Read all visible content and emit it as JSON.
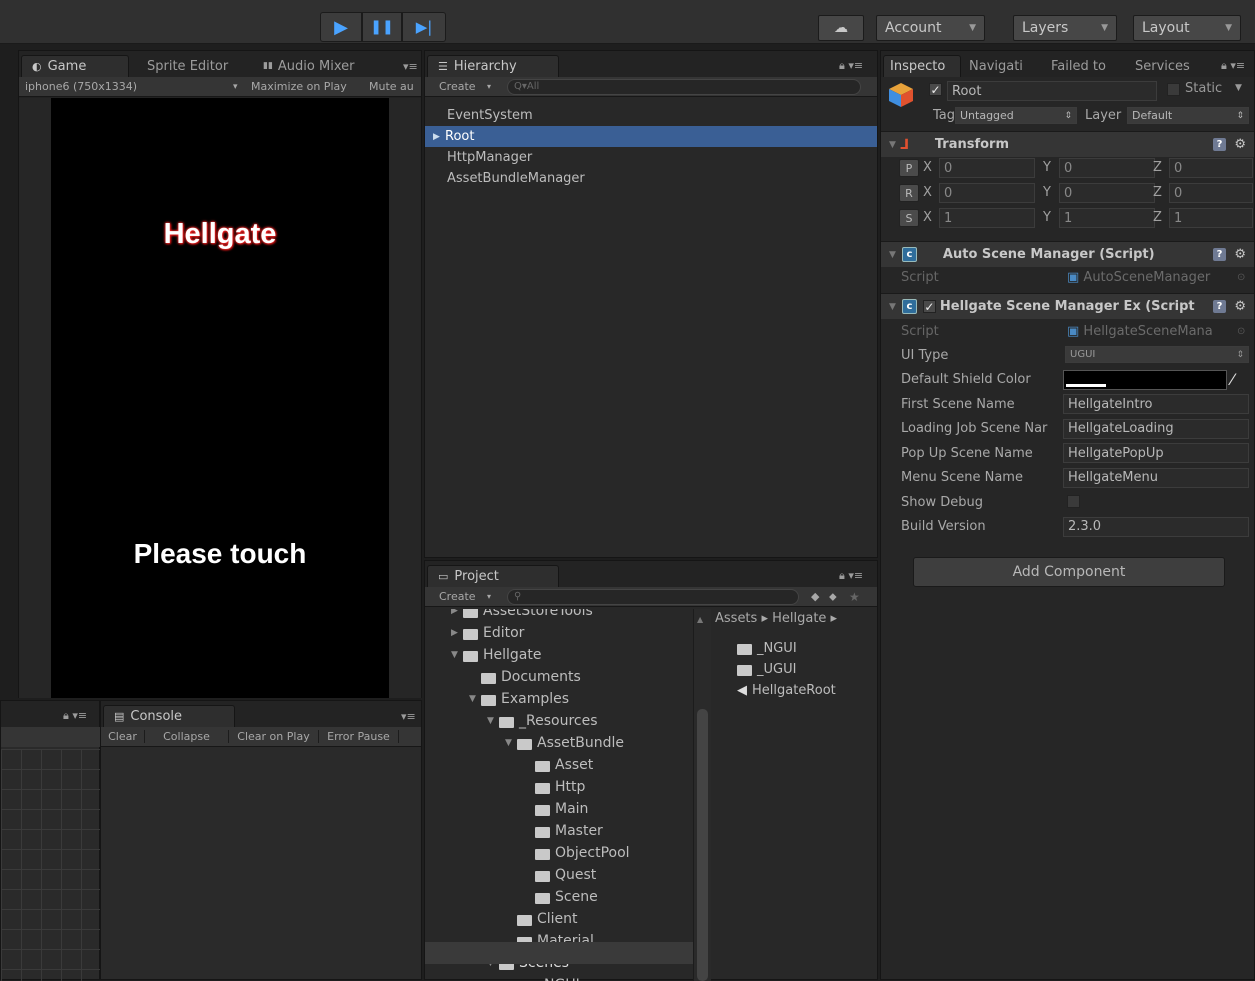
{
  "toolbar": {
    "play_icon": "play-icon",
    "account_label": "Account",
    "layers_label": "Layers",
    "layout_label": "Layout"
  },
  "game_panel": {
    "tabs": [
      "Game",
      "Sprite Editor",
      "Audio Mixer"
    ],
    "resolution": "iphone6 (750x1334)",
    "maximize_on_play": "Maximize on Play",
    "mute_audio": "Mute au",
    "title_text": "Hellgate",
    "touch_text": "Please touch"
  },
  "hierarchy": {
    "tab": "Hierarchy",
    "create_label": "Create",
    "search_placeholder": "Q▾All",
    "items": [
      "EventSystem",
      "Root",
      "HttpManager",
      "AssetBundleManager"
    ]
  },
  "console": {
    "tab": "Console",
    "buttons": [
      "Clear",
      "Collapse",
      "Clear on Play",
      "Error Pause"
    ]
  },
  "project": {
    "tab": "Project",
    "create_label": "Create",
    "tree": [
      {
        "label": "AssetStoreTools",
        "depth": 0
      },
      {
        "label": "Editor",
        "depth": 0
      },
      {
        "label": "Hellgate",
        "depth": 0
      },
      {
        "label": "Documents",
        "depth": 1
      },
      {
        "label": "Examples",
        "depth": 1
      },
      {
        "label": "_Resources",
        "depth": 2
      },
      {
        "label": "AssetBundle",
        "depth": 3
      },
      {
        "label": "Asset",
        "depth": 4
      },
      {
        "label": "Http",
        "depth": 4
      },
      {
        "label": "Main",
        "depth": 4
      },
      {
        "label": "Master",
        "depth": 4
      },
      {
        "label": "ObjectPool",
        "depth": 4
      },
      {
        "label": "Quest",
        "depth": 4
      },
      {
        "label": "Scene",
        "depth": 4
      },
      {
        "label": "Client",
        "depth": 3
      },
      {
        "label": "Material",
        "depth": 3
      },
      {
        "label": "Scenes",
        "depth": 2
      },
      {
        "label": "_NGUI",
        "depth": 3
      }
    ],
    "breadcrumb": "Assets ▸ Hellgate ▸",
    "assets": [
      "_NGUI",
      "_UGUI",
      "HellgateRoot"
    ]
  },
  "inspector": {
    "tabs": [
      "Inspecto",
      "Navigati",
      "Failed to",
      "Services"
    ],
    "object_name": "Root",
    "static_label": "Static",
    "tag_label": "Tag",
    "tag_value": "Untagged",
    "layer_label": "Layer",
    "layer_value": "Default",
    "transform": {
      "title": "Transform",
      "rows": [
        {
          "btn": "P",
          "x": "0",
          "y": "0",
          "z": "0"
        },
        {
          "btn": "R",
          "x": "0",
          "y": "0",
          "z": "0"
        },
        {
          "btn": "S",
          "x": "1",
          "y": "1",
          "z": "1"
        }
      ]
    },
    "auto_scene": {
      "title": "Auto Scene Manager (Script)",
      "script_label": "Script",
      "script_value": "AutoSceneManager"
    },
    "hellgate_scene": {
      "title": "Hellgate Scene Manager Ex (Script",
      "script_label": "Script",
      "script_value": "HellgateSceneMana",
      "fields": [
        {
          "label": "UI Type",
          "value": "UGUI"
        },
        {
          "label": "Default Shield Color",
          "value": ""
        },
        {
          "label": "First Scene Name",
          "value": "HellgateIntro"
        },
        {
          "label": "Loading Job Scene Nar",
          "value": "HellgateLoading"
        },
        {
          "label": "Pop Up Scene Name",
          "value": "HellgatePopUp"
        },
        {
          "label": "Menu Scene Name",
          "value": "HellgateMenu"
        },
        {
          "label": "Show Debug",
          "value": ""
        },
        {
          "label": "Build Version",
          "value": "2.3.0"
        }
      ]
    },
    "add_component": "Add Component"
  },
  "colors": {
    "selection": "#3a5f95",
    "play_blue": "#4aa3ff",
    "title_red_glow": "#ff3b3b"
  }
}
